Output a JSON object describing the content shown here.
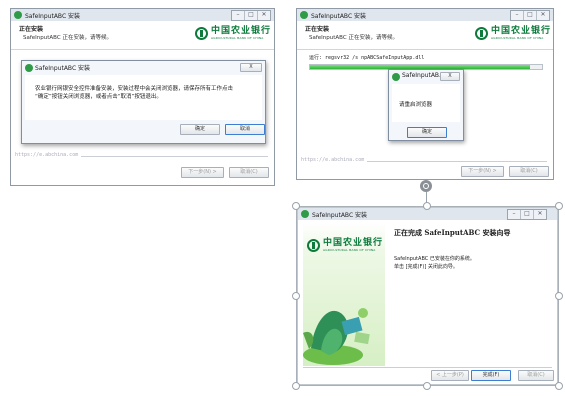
{
  "panel1": {
    "window_title": "SafeInputABC 安装",
    "header_title": "正在安装",
    "header_subtitle": "SafeInputABC 正在安装，请等候。",
    "logo_cn": "中国农业银行",
    "logo_en": "AGRICULTURAL BANK OF CHINA",
    "url_text": "https://e.abchina.com",
    "back_label": "< 上一步(B)",
    "next_label": "下一步(N) >",
    "cancel_label": "取消(C)",
    "dialog": {
      "title": "SafeInputABC 安装",
      "close_glyph": "X",
      "message": "农业银行网银安全控件准备安装，安装过程中会关闭浏览器，请保存所有工作点击\n“确定”按钮关闭浏览器，或者点击“取消”按钮退出。",
      "ok_label": "确定",
      "cancel_label": "取消"
    }
  },
  "panel2": {
    "window_title": "SafeInputABC 安装",
    "header_title": "正在安装",
    "header_subtitle": "SafeInputABC 正在安装，请等候。",
    "logo_cn": "中国农业银行",
    "logo_en": "AGRICULTURAL BANK OF CHINA",
    "run_text": "运行: regsvr32 /s npABCSafeInputApp.dll",
    "progress": 0.95,
    "url_text": "https://e.abchina.com",
    "next_label": "下一步(N) >",
    "cancel_label": "取消(C)",
    "dialog": {
      "title": "SafeInputAB...",
      "close_glyph": "X",
      "message": "请重启浏览器",
      "ok_label": "确定"
    }
  },
  "panel3": {
    "window_title": "SafeInputABC 安装",
    "logo_cn": "中国农业银行",
    "logo_en": "AGRICULTURAL BANK OF CHINA",
    "finish_title": "正在完成 SafeInputABC 安装向导",
    "finish_line1": "SafeInputABC 已安装在你的系统。",
    "finish_line2": "单击 [完成(F)] 关闭此向导。",
    "back_label": "< 上一步(P)",
    "finish_label": "完成(F)",
    "cancel_label": "取消(C)"
  },
  "colors": {
    "brand_green": "#0d7a3c",
    "progress_green": "#3fc34a",
    "titlebar": "#dfe6ee"
  }
}
